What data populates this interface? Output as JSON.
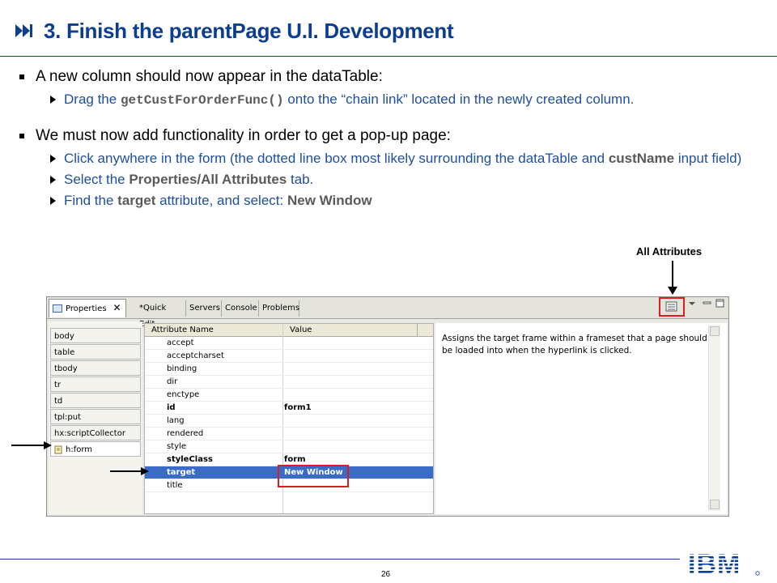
{
  "slide": {
    "title": "3. Finish the parentPage U.I. Development",
    "page_number": "26",
    "bullets": {
      "b1": "A new column should now appear in the dataTable:",
      "b1_sub1_pre": "Drag the",
      "b1_sub1_code": "getCustForOrderFunc()",
      "b1_sub1_post": "onto the “chain link” located in the newly created column.",
      "b2": "We must now add functionality in order to get a pop-up page:",
      "b2_sub1_pre": "Click anywhere in the form (the dotted line box most likely surrounding the dataTable and",
      "b2_sub1_bold": "custName",
      "b2_sub1_post": "input field)",
      "b2_sub2_pre": "Select the",
      "b2_sub2_bold": "Properties/All Attributes",
      "b2_sub2_post": "tab.",
      "b2_sub3_pre": "Find the",
      "b2_sub3_bold1": "target",
      "b2_sub3_mid": "attribute, and select:",
      "b2_sub3_bold2": "New Window"
    },
    "callout_label": "All Attributes",
    "logo_text": "IBM"
  },
  "screenshot": {
    "tabs": [
      "Properties",
      "*Quick Edit",
      "Servers",
      "Console",
      "Problems"
    ],
    "close_glyph": "✕",
    "tree_items": [
      "body",
      "table",
      "tbody",
      "tr",
      "td",
      "tpl:put",
      "hx:scriptCollector",
      "h:form"
    ],
    "table_headers": {
      "name": "Attribute Name",
      "value": "Value"
    },
    "rows": [
      {
        "name": "accept",
        "value": ""
      },
      {
        "name": "acceptcharset",
        "value": ""
      },
      {
        "name": "binding",
        "value": ""
      },
      {
        "name": "dir",
        "value": ""
      },
      {
        "name": "enctype",
        "value": ""
      },
      {
        "name": "id",
        "value": "form1"
      },
      {
        "name": "lang",
        "value": ""
      },
      {
        "name": "rendered",
        "value": ""
      },
      {
        "name": "style",
        "value": ""
      },
      {
        "name": "styleClass",
        "value": "form"
      },
      {
        "name": "target",
        "value": "New Window"
      },
      {
        "name": "title",
        "value": ""
      }
    ],
    "description": "Assigns the target frame within a frameset that a page should be loaded into when the hyperlink is clicked."
  },
  "colors": {
    "title_blue": "#0b3d91",
    "highlight_red": "#d81e1e",
    "selection_blue": "#3a6bc6"
  }
}
